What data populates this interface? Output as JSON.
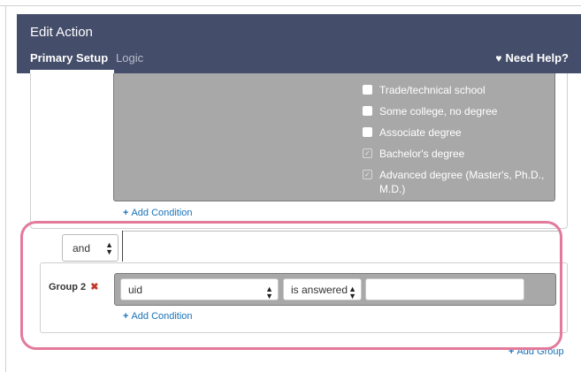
{
  "header": {
    "title": "Edit Action",
    "tabs": [
      {
        "label": "Primary Setup"
      },
      {
        "label": "Logic"
      }
    ],
    "help_label": "Need Help?"
  },
  "group1": {
    "options": [
      {
        "label": "Trade/technical school",
        "checked": false
      },
      {
        "label": "Some college, no degree",
        "checked": false
      },
      {
        "label": "Associate degree",
        "checked": false
      },
      {
        "label": "Bachelor's degree",
        "checked": true
      },
      {
        "label": "Advanced degree (Master's, Ph.D., M.D.)",
        "checked": true
      }
    ],
    "add_condition_label": "Add Condition"
  },
  "connector": {
    "selected": "and"
  },
  "group2": {
    "label": "Group 2",
    "field_value": "uid",
    "operator_value": "is answered",
    "value_text": "",
    "add_condition_label": "Add Condition"
  },
  "add_group_label": "Add Group",
  "colors": {
    "header_bg": "#444d6a",
    "link": "#1a73b8",
    "highlight": "#e37a9b",
    "remove": "#c0392b"
  }
}
